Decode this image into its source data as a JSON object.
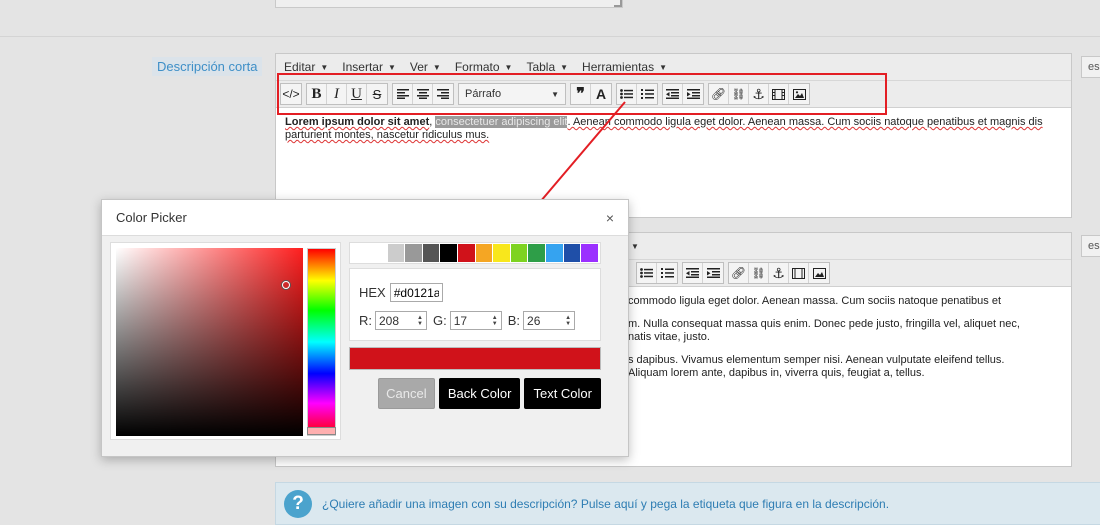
{
  "field": {
    "label": "Descripción corta"
  },
  "editor": {
    "menu": [
      "Editar",
      "Insertar",
      "Ver",
      "Formato",
      "Tabla",
      "Herramientas"
    ],
    "menu_partial_second": "s",
    "format_select": "Párrafo",
    "side_button": "es",
    "content1": {
      "bold": "Lorem ipsum dolor sit amet",
      "comma": ",",
      "highlight": "consectetuer adipiscing elit",
      "rest": ". Aenean commodo ligula eget dolor. Aenean massa. Cum sociis natoque penatibus et magnis dis parturient montes, nascetur ridiculus mus."
    },
    "content2": [
      "commodo ligula eget dolor. Aenean massa. Cum sociis natoque penatibus et",
      "m. Nulla consequat massa quis enim. Donec pede justo, fringilla vel, aliquet nec, natis vitae, justo.",
      "s dapibus. Vivamus elementum semper nisi. Aenean vulputate eleifend tellus. Aliquam lorem ante, dapibus in, viverra quis, feugiat a, tellus."
    ]
  },
  "color_picker": {
    "title": "Color Picker",
    "close": "×",
    "hex_label": "HEX",
    "hex_value": "#d0121a",
    "r_label": "R:",
    "r_value": "208",
    "g_label": "G:",
    "g_value": "17",
    "b_label": "B:",
    "b_value": "26",
    "swatches": [
      "#ffffff",
      "#cccccc",
      "#999999",
      "#555555",
      "#000000",
      "#d0121a",
      "#f5a623",
      "#f8e71c",
      "#7ed321",
      "#2e9e48",
      "#35a3f0",
      "#1f4fa8",
      "#9b30ff"
    ],
    "cancel_label": "Cancel",
    "back_color_label": "Back Color",
    "text_color_label": "Text Color"
  },
  "info": {
    "icon": "?",
    "question": "¿Quiere añadir una imagen con su descripción? ",
    "link": "Pulse aquí",
    "rest": " y pega la etiqueta que figura en la descripción."
  },
  "colors": {
    "accent_red": "#e31e24",
    "selected_color": "#d0121a",
    "link": "#2e7db3"
  }
}
